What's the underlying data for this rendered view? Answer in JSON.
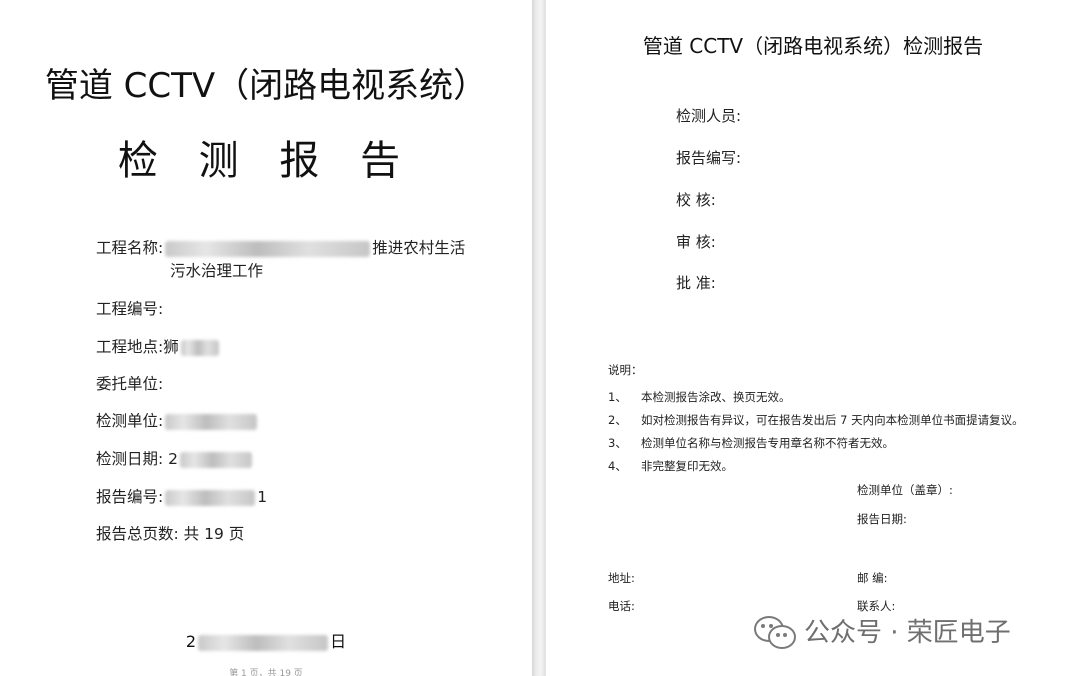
{
  "left_page": {
    "title_line1": "管道 CCTV（闭路电视系统）",
    "title_line2": "检 测 报 告",
    "fields": {
      "project_name_label": "工程名称:",
      "project_name_visible_tail": "推进农村生活",
      "project_name_line2": "污水治理工作",
      "project_no_label": "工程编号:",
      "project_site_label": "工程地点:",
      "project_site_visible": "狮",
      "client_label": "委托单位:",
      "inspector_unit_label": "检测单位:",
      "inspect_date_label": "检测日期:",
      "inspect_date_visible": "2",
      "report_no_label": "报告编号:",
      "report_no_visible_tail": "1",
      "total_pages_label": "报告总页数:",
      "total_pages_value": "共 19 页"
    },
    "footer_date_visible": "2",
    "footer_date_tail": "日",
    "page_number": "第 1 页，共 19 页"
  },
  "right_page": {
    "title": "管道 CCTV（闭路电视系统）检测报告",
    "signatures": [
      "检测人员:",
      "报告编写:",
      "校      核:",
      "审      核:",
      "批      准:"
    ],
    "notes_heading": "说明：",
    "notes": [
      {
        "num": "1、",
        "text": "本检测报告涂改、换页无效。"
      },
      {
        "num": "2、",
        "text": "如对检测报告有异议，可在报告发出后 7 天内向本检测单位书面提请复议。"
      },
      {
        "num": "3、",
        "text": "检测单位名称与检测报告专用章名称不符者无效。"
      },
      {
        "num": "4、",
        "text": "非完整复印无效。"
      }
    ],
    "stamp_label": "检测单位（盖章）:",
    "report_date_label": "报告日期:",
    "address_label": "地址:",
    "postcode_label": "邮    编:",
    "phone_label": "电话:",
    "contact_label": "联系人:"
  },
  "watermark": {
    "text": "公众号 · 荣匠电子",
    "icon": "wechat-icon"
  }
}
